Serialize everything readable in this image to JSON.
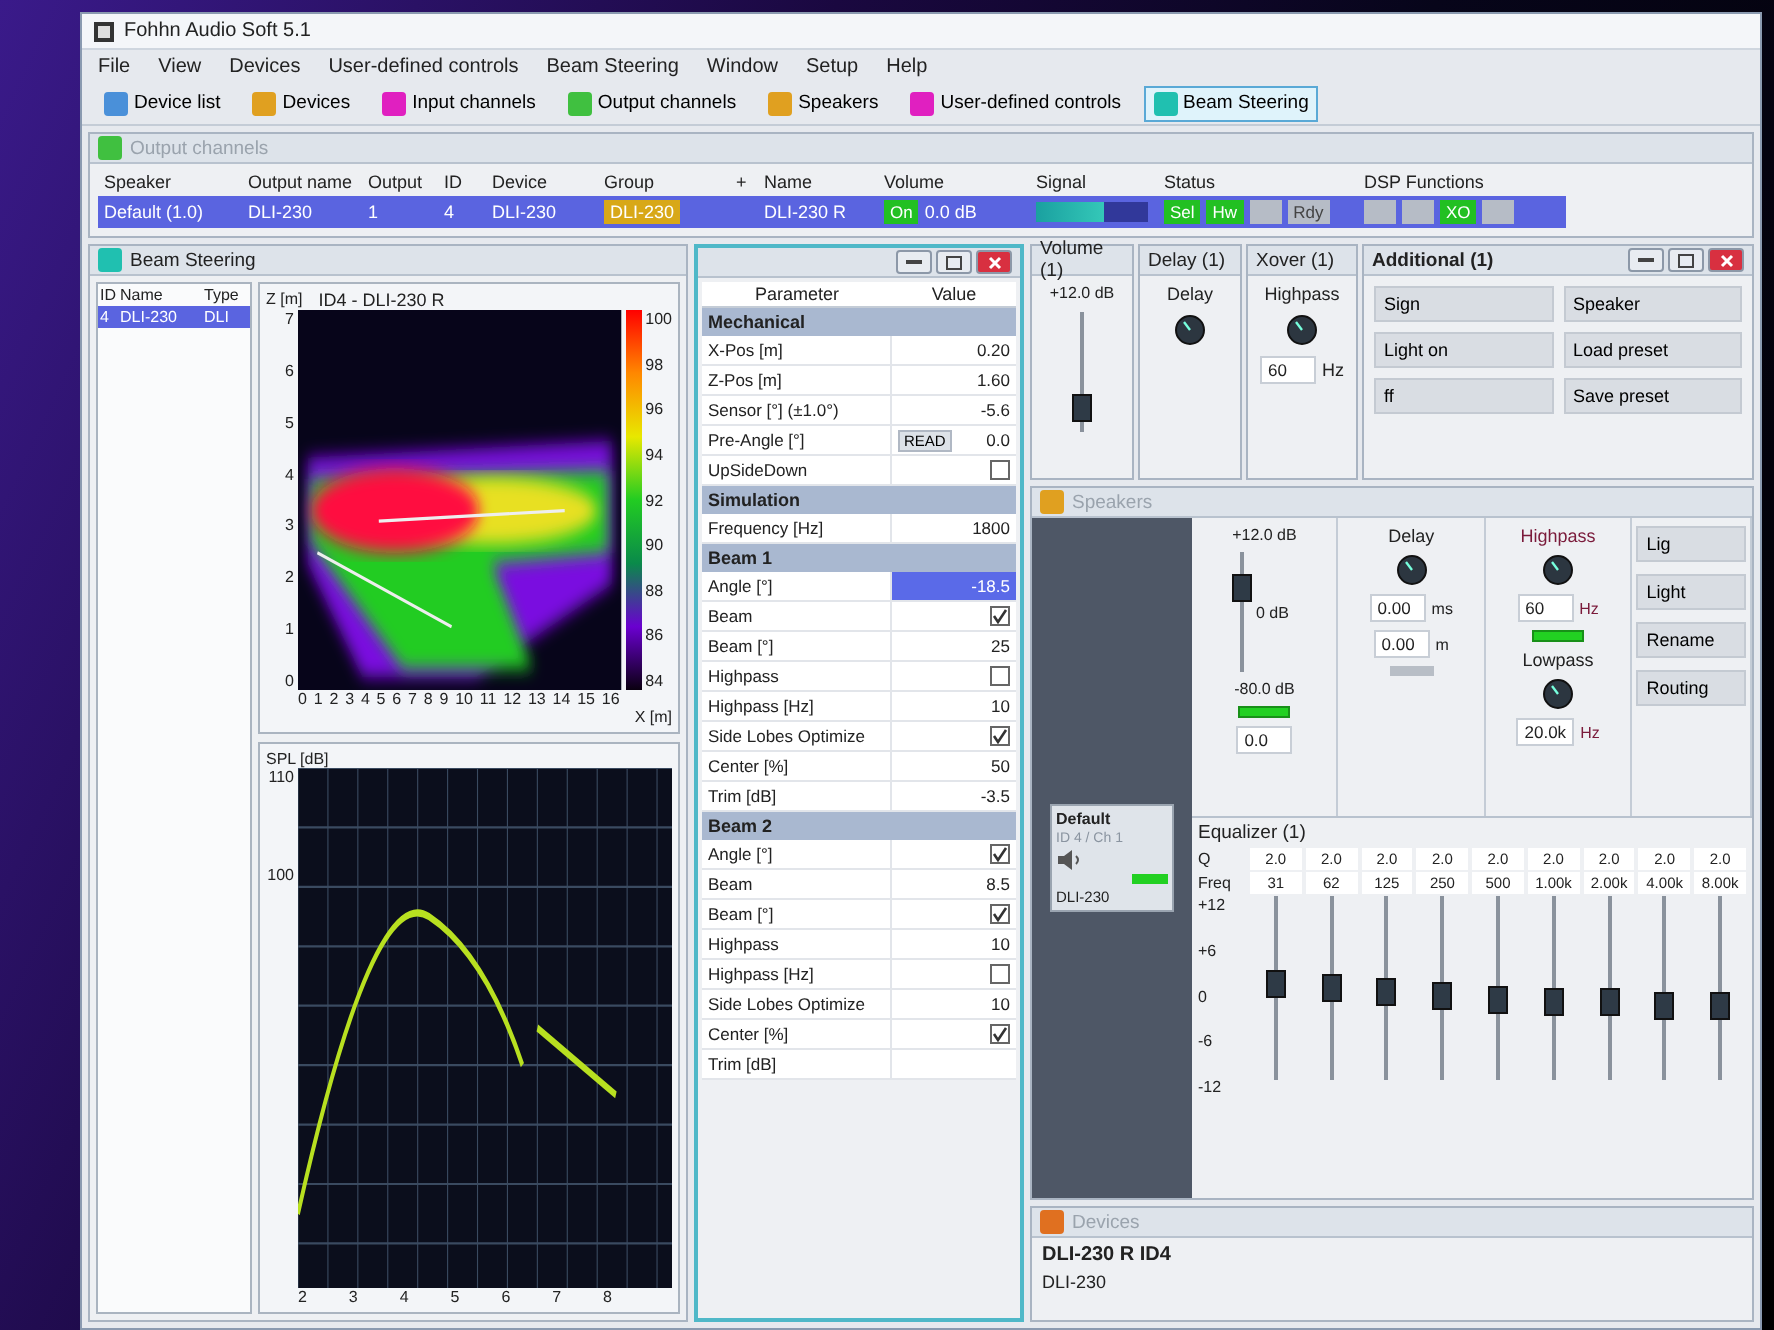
{
  "window": {
    "title": "Fohhn Audio Soft 5.1"
  },
  "menu": [
    "File",
    "View",
    "Devices",
    "User-defined controls",
    "Beam Steering",
    "Window",
    "Setup",
    "Help"
  ],
  "toolbar": [
    {
      "label": "Device list",
      "color": "#4a90d9",
      "selected": false
    },
    {
      "label": "Devices",
      "color": "#e0a020",
      "selected": false
    },
    {
      "label": "Input channels",
      "color": "#e020c0",
      "selected": false
    },
    {
      "label": "Output channels",
      "color": "#40c040",
      "selected": false
    },
    {
      "label": "Speakers",
      "color": "#e0a020",
      "selected": false
    },
    {
      "label": "User-defined controls",
      "color": "#e020c0",
      "selected": false
    },
    {
      "label": "Beam Steering",
      "color": "#20c0b0",
      "selected": true
    }
  ],
  "output_channels": {
    "title": "Output channels",
    "columns": [
      "Speaker",
      "Output name",
      "Output",
      "ID",
      "Device",
      "Group",
      "+",
      "Name",
      "Volume",
      "Signal",
      "Status",
      "DSP Functions"
    ],
    "rows": [
      {
        "selected": true,
        "speaker": "Default (1.0)",
        "output_name": "DLI-230",
        "output": "1",
        "id": "4",
        "device": "DLI-230",
        "group": "DLI-230",
        "name": "DLI-230 R",
        "volume_switch": {
          "label": "On",
          "on": true
        },
        "volume": "0.0 dB",
        "signal": {
          "level": 0.6
        },
        "status": [
          {
            "label": "Sel",
            "on": true
          },
          {
            "label": "Hw",
            "on": true
          },
          {
            "on": false
          },
          {
            "label": "Rdy",
            "on": false
          }
        ],
        "dsp": [
          {
            "on": false
          },
          {
            "on": false
          },
          {
            "label": "XO",
            "on": true
          },
          {
            "on": false
          }
        ]
      }
    ]
  },
  "beam_steering": {
    "title": "Beam Steering",
    "list": {
      "columns": [
        "ID",
        "Name",
        "Type"
      ],
      "rows": [
        {
          "cells": [
            "4",
            "DLI-230",
            "DLI"
          ],
          "selected": true
        }
      ]
    },
    "heatmap": {
      "ylabel": "Z [m]",
      "title": "ID4 - DLI-230 R",
      "xlabel": "X [m]",
      "yticks": [
        "7",
        "6",
        "5",
        "4",
        "3",
        "2",
        "1",
        "0"
      ],
      "xticks": [
        "0",
        "1",
        "2",
        "3",
        "4",
        "5",
        "6",
        "7",
        "8",
        "9",
        "10",
        "11",
        "12",
        "13",
        "14",
        "15",
        "16"
      ],
      "scale": [
        "100",
        "98",
        "96",
        "94",
        "92",
        "90",
        "88",
        "86",
        "84"
      ]
    },
    "spl": {
      "ylabel": "SPL [dB]",
      "yticks": [
        "110",
        "100"
      ],
      "xticks": [
        "2",
        "3",
        "4",
        "5",
        "6",
        "7",
        "8"
      ]
    }
  },
  "parameters": {
    "columns": [
      "Parameter",
      "Value"
    ],
    "rows": [
      {
        "kind": "section",
        "label": "Mechanical"
      },
      {
        "kind": "text",
        "label": "X-Pos [m]",
        "value": "0.20",
        "selected": false
      },
      {
        "kind": "text",
        "label": "Z-Pos [m]",
        "value": "1.60",
        "selected": false
      },
      {
        "kind": "text",
        "label": "Sensor [°] (±1.0°)",
        "value": "-5.6",
        "selected": false
      },
      {
        "kind": "button",
        "label": "Pre-Angle [°]",
        "button": "READ",
        "value": "0.0",
        "selected": false
      },
      {
        "kind": "check",
        "label": "UpSideDown",
        "checked": false,
        "selected": false
      },
      {
        "kind": "section",
        "label": "Simulation"
      },
      {
        "kind": "text",
        "label": "Frequency [Hz]",
        "value": "1800",
        "selected": false
      },
      {
        "kind": "section",
        "label": "Beam 1"
      },
      {
        "kind": "text",
        "label": "Angle [°]",
        "value": "-18.5",
        "selected": true
      },
      {
        "kind": "check",
        "label": "Beam",
        "checked": true,
        "selected": false
      },
      {
        "kind": "text",
        "label": "Beam [°]",
        "value": "25",
        "selected": false
      },
      {
        "kind": "check",
        "label": "Highpass",
        "checked": false,
        "selected": false
      },
      {
        "kind": "text",
        "label": "Highpass [Hz]",
        "value": "10",
        "selected": false
      },
      {
        "kind": "check",
        "label": "Side Lobes Optimize",
        "checked": true,
        "selected": false
      },
      {
        "kind": "text",
        "label": "Center [%]",
        "value": "50",
        "selected": false
      },
      {
        "kind": "text",
        "label": "Trim [dB]",
        "value": "-3.5",
        "selected": false
      },
      {
        "kind": "section",
        "label": "Beam 2"
      },
      {
        "kind": "check",
        "label": "Angle [°]",
        "checked": true,
        "selected": false
      },
      {
        "kind": "text",
        "label": "Beam",
        "value": "8.5",
        "selected": false
      },
      {
        "kind": "check",
        "label": "Beam [°]",
        "checked": true,
        "selected": false
      },
      {
        "kind": "text",
        "label": "Highpass",
        "value": "10",
        "selected": false
      },
      {
        "kind": "check",
        "label": "Highpass [Hz]",
        "checked": false,
        "selected": false
      },
      {
        "kind": "text",
        "label": "Side Lobes Optimize",
        "value": "10",
        "selected": false
      },
      {
        "kind": "check",
        "label": "Center [%]",
        "checked": true,
        "selected": false
      },
      {
        "kind": "text",
        "label": "Trim [dB]",
        "selected": false
      }
    ]
  },
  "dsp_panels": {
    "volume": {
      "title": "Volume (1)",
      "max": "+12.0 dB",
      "level": 0.2
    },
    "delay": {
      "title": "Delay (1)",
      "label": "Delay"
    },
    "xover": {
      "title": "Xover (1)",
      "label": "Highpass",
      "value": "60",
      "unit": "Hz"
    },
    "additional": {
      "title": "Additional (1)",
      "buttons": [
        "Sign",
        "Speaker",
        "Light on",
        "Load preset",
        "ff",
        "Save preset"
      ]
    }
  },
  "speakers": {
    "title": "Speakers",
    "card": {
      "name": "Default",
      "channel": "ID 4 / Ch 1",
      "model": "DLI-230"
    },
    "volume": {
      "max": "+12.0 dB",
      "mid": "0 dB",
      "min": "-80.0 dB",
      "level": 0.7,
      "value": "0.0"
    },
    "delay": {
      "label": "Delay",
      "ms": "0.00",
      "ms_unit": "ms",
      "m": "0.00",
      "m_unit": "m"
    },
    "xover": {
      "highpass": "Highpass",
      "hp_value": "60",
      "hp_unit": "Hz",
      "lowpass": "Lowpass",
      "lp_value": "20.0k",
      "lp_unit": "Hz"
    },
    "side_buttons": [
      "Lig",
      "Light",
      "Rename",
      "Routing"
    ],
    "equalizer": {
      "title": "Equalizer (1)",
      "q_label": "Q",
      "freq_label": "Freq",
      "scale": [
        "+12",
        "+6",
        "0",
        "-6",
        "-12"
      ],
      "bands": [
        {
          "q": "2.0",
          "freq": "31",
          "level": 0.52
        },
        {
          "q": "2.0",
          "freq": "62",
          "level": 0.5
        },
        {
          "q": "2.0",
          "freq": "125",
          "level": 0.48
        },
        {
          "q": "2.0",
          "freq": "250",
          "level": 0.46
        },
        {
          "q": "2.0",
          "freq": "500",
          "level": 0.44
        },
        {
          "q": "2.0",
          "freq": "1.00k",
          "level": 0.42
        },
        {
          "q": "2.0",
          "freq": "2.00k",
          "level": 0.42
        },
        {
          "q": "2.0",
          "freq": "4.00k",
          "level": 0.4
        },
        {
          "q": "2.0",
          "freq": "8.00k",
          "level": 0.4
        }
      ]
    }
  },
  "devices": {
    "title": "Devices",
    "device": "DLI-230 R ID4",
    "model": "DLI-230"
  }
}
